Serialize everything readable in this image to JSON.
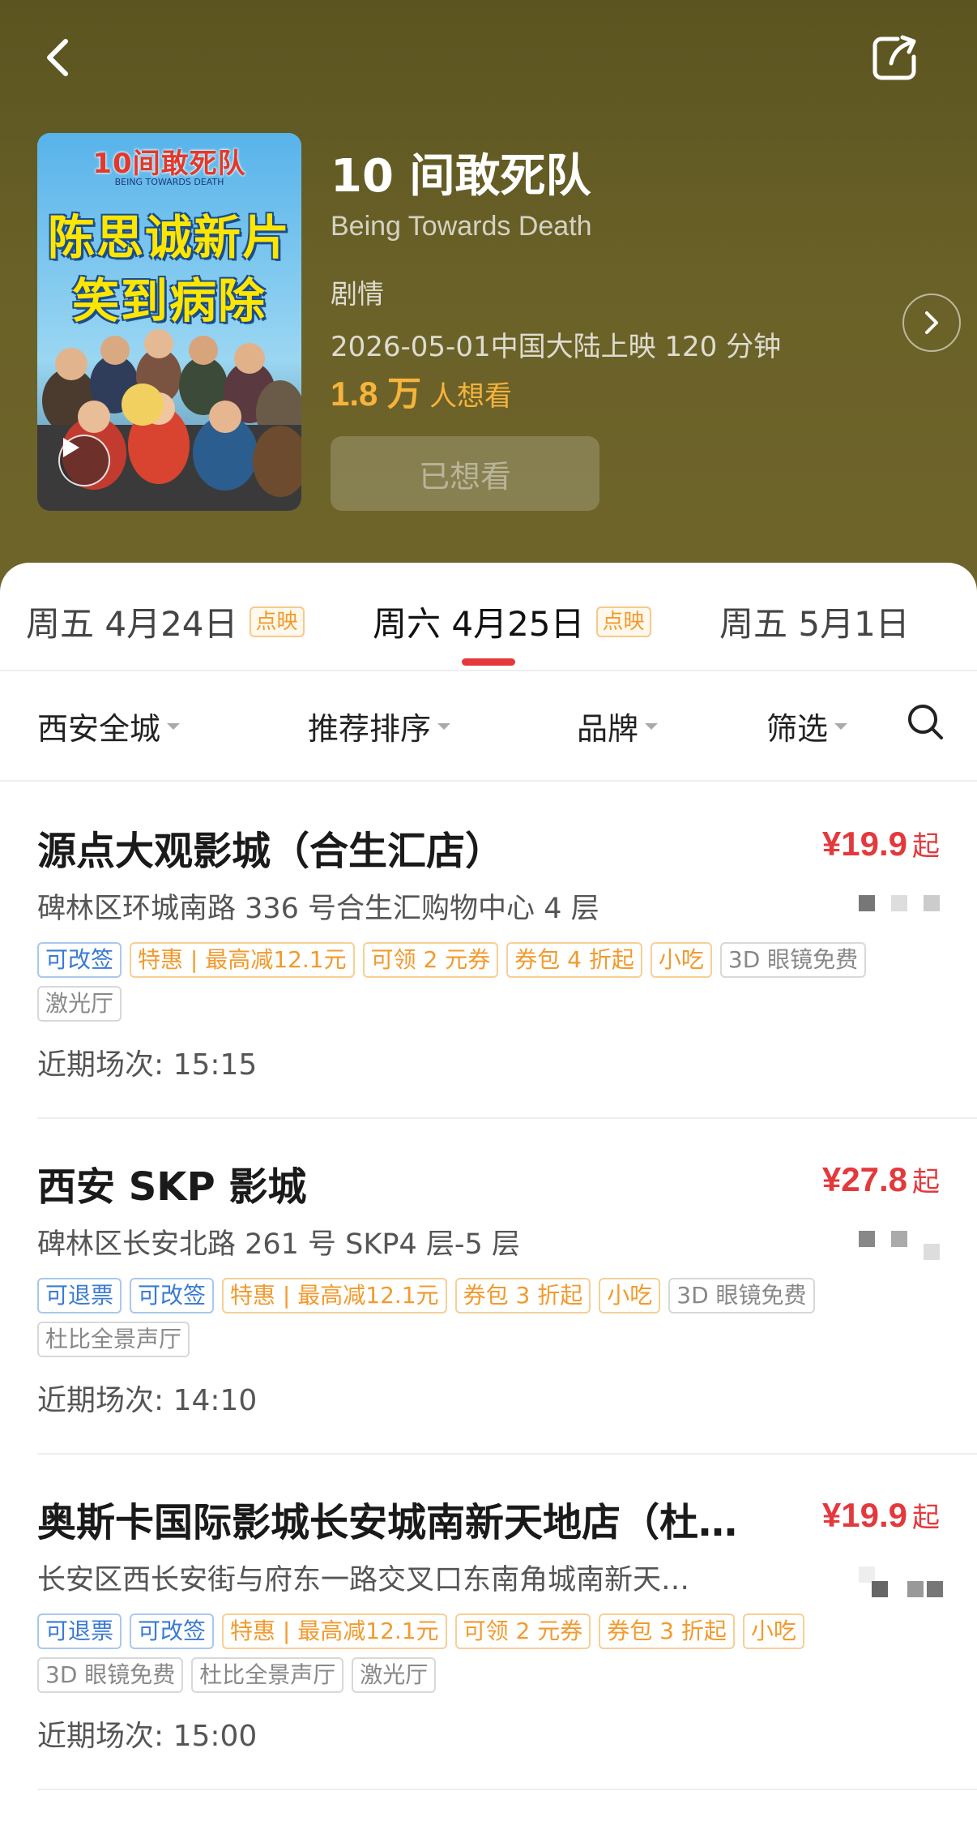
{
  "header": {
    "back_label": "",
    "share_label": ""
  },
  "poster": {
    "title": "10间敢死队",
    "subtitle": "BEING TOWARDS DEATH",
    "line1": "陈思诚新片",
    "line2": "笑到病除"
  },
  "movie": {
    "title": "10 间敢死队",
    "english_title": "Being Towards Death",
    "genre": "剧情",
    "release": "2026-05-01中国大陆上映 120 分钟",
    "want_count": "1.8 万",
    "want_suffix": "人想看",
    "wanted_button": "已想看"
  },
  "date_tabs": [
    {
      "label": "周五  4月24日",
      "tag": "点映",
      "active": false
    },
    {
      "label": "周六  4月25日",
      "tag": "点映",
      "active": true
    },
    {
      "label": "周五  5月1日",
      "tag": "",
      "active": false
    }
  ],
  "filters": {
    "city": "西安全城",
    "sort": "推荐排序",
    "brand": "品牌",
    "filter": "筛选"
  },
  "cinemas": [
    {
      "name": "源点大观影城（合生汇店）",
      "price": "¥19.9",
      "price_suffix": "起",
      "address": "碑林区环城南路 336 号合生汇购物中心 4 层",
      "tags_row1": [
        {
          "text": "可改签",
          "color": "blue"
        },
        {
          "text": "特惠 | 最高减12.1元",
          "color": "orange"
        },
        {
          "text": "可领 2 元券",
          "color": "orange"
        },
        {
          "text": "券包 4 折起",
          "color": "orange"
        },
        {
          "text": "小吃",
          "color": "orange"
        },
        {
          "text": "3D 眼镜免费",
          "color": "gray"
        }
      ],
      "tags_row2": [
        {
          "text": "激光厅",
          "color": "gray"
        }
      ],
      "showtime": "近期场次: 15:15"
    },
    {
      "name": "西安 SKP 影城",
      "price": "¥27.8",
      "price_suffix": "起",
      "address": "碑林区长安北路 261 号 SKP4 层-5 层",
      "tags_row1": [
        {
          "text": "可退票",
          "color": "blue"
        },
        {
          "text": "可改签",
          "color": "blue"
        },
        {
          "text": "特惠 | 最高减12.1元",
          "color": "orange"
        },
        {
          "text": "券包 3 折起",
          "color": "orange"
        },
        {
          "text": "小吃",
          "color": "orange"
        },
        {
          "text": "3D 眼镜免费",
          "color": "gray"
        }
      ],
      "tags_row2": [
        {
          "text": "杜比全景声厅",
          "color": "gray"
        }
      ],
      "showtime": "近期场次: 14:10"
    },
    {
      "name": "奥斯卡国际影城长安城南新天地店（杜…",
      "price": "¥19.9",
      "price_suffix": "起",
      "address": "长安区西长安街与府东一路交叉口东南角城南新天…",
      "tags_row1": [
        {
          "text": "可退票",
          "color": "blue"
        },
        {
          "text": "可改签",
          "color": "blue"
        },
        {
          "text": "特惠 | 最高减12.1元",
          "color": "orange"
        },
        {
          "text": "可领 2 元券",
          "color": "orange"
        },
        {
          "text": "券包 3 折起",
          "color": "orange"
        },
        {
          "text": "小吃",
          "color": "orange"
        }
      ],
      "tags_row2": [
        {
          "text": "3D 眼镜免费",
          "color": "gray"
        },
        {
          "text": "杜比全景声厅",
          "color": "gray"
        },
        {
          "text": "激光厅",
          "color": "gray"
        }
      ],
      "showtime": "近期场次: 15:00"
    }
  ],
  "colors": {
    "header_bg": "#6a6128",
    "price_red": "#e4393c",
    "want_orange": "#f6b43c",
    "tag_blue": "#3a7bd5",
    "tag_orange": "#f29a2e",
    "tag_gray": "#888888"
  },
  "icons": {
    "back": "chevron-left-icon",
    "share": "share-icon",
    "play": "play-icon",
    "detail": "chevron-right-icon",
    "search": "search-icon"
  }
}
